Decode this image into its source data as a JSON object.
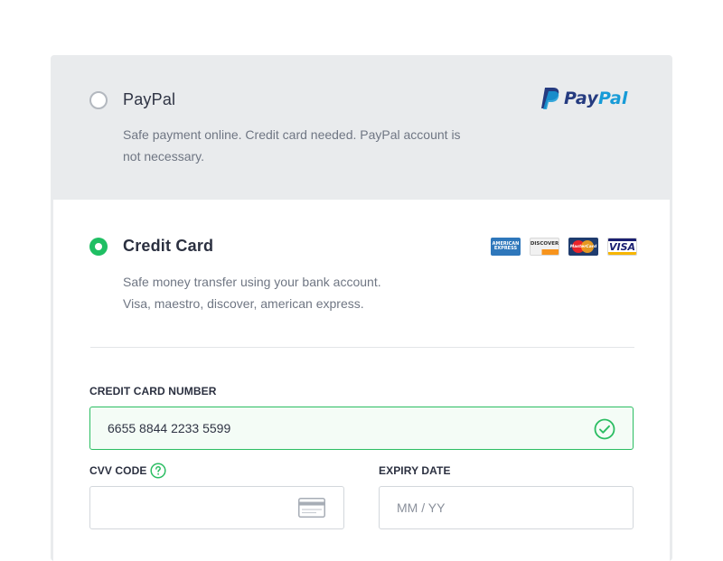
{
  "paypal": {
    "title": "PayPal",
    "description_line1": "Safe payment online. Credit card needed. PayPal account is",
    "description_line2": "not necessary.",
    "logo_pay": "Pay",
    "logo_pal": "Pal",
    "selected": false
  },
  "credit_card": {
    "title": "Credit Card",
    "description_line1": "Safe money transfer using your bank account.",
    "description_line2": "Visa, maestro, discover, american express.",
    "selected": true,
    "logos": {
      "amex_line1": "AMERICAN",
      "amex_line2": "EXPRESS",
      "discover": "DISCOVER",
      "mastercard": "MasterCard",
      "visa": "VISA"
    }
  },
  "form": {
    "card_number_label": "CREDIT CARD NUMBER",
    "card_number_value": "6655 8844 2233 5599",
    "cvv_label": "CVV CODE",
    "cvv_value": "",
    "expiry_label": "EXPIRY DATE",
    "expiry_placeholder": "MM / YY"
  },
  "colors": {
    "accent_green": "#1fbf63",
    "panel_gray": "#e9ebed",
    "paypal_dark": "#253b80",
    "paypal_light": "#179bd7"
  }
}
